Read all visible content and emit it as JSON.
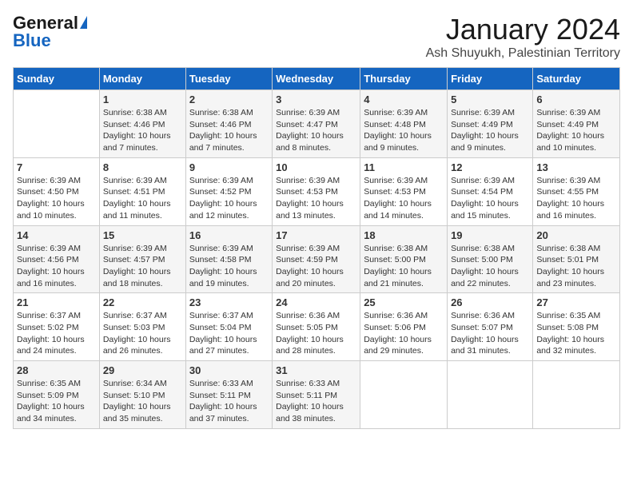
{
  "header": {
    "logo_general": "General",
    "logo_blue": "Blue",
    "month_title": "January 2024",
    "location": "Ash Shuyukh, Palestinian Territory"
  },
  "days_of_week": [
    "Sunday",
    "Monday",
    "Tuesday",
    "Wednesday",
    "Thursday",
    "Friday",
    "Saturday"
  ],
  "weeks": [
    [
      {
        "day": "",
        "sunrise": "",
        "sunset": "",
        "daylight": ""
      },
      {
        "day": "1",
        "sunrise": "Sunrise: 6:38 AM",
        "sunset": "Sunset: 4:46 PM",
        "daylight": "Daylight: 10 hours and 7 minutes."
      },
      {
        "day": "2",
        "sunrise": "Sunrise: 6:38 AM",
        "sunset": "Sunset: 4:46 PM",
        "daylight": "Daylight: 10 hours and 7 minutes."
      },
      {
        "day": "3",
        "sunrise": "Sunrise: 6:39 AM",
        "sunset": "Sunset: 4:47 PM",
        "daylight": "Daylight: 10 hours and 8 minutes."
      },
      {
        "day": "4",
        "sunrise": "Sunrise: 6:39 AM",
        "sunset": "Sunset: 4:48 PM",
        "daylight": "Daylight: 10 hours and 9 minutes."
      },
      {
        "day": "5",
        "sunrise": "Sunrise: 6:39 AM",
        "sunset": "Sunset: 4:49 PM",
        "daylight": "Daylight: 10 hours and 9 minutes."
      },
      {
        "day": "6",
        "sunrise": "Sunrise: 6:39 AM",
        "sunset": "Sunset: 4:49 PM",
        "daylight": "Daylight: 10 hours and 10 minutes."
      }
    ],
    [
      {
        "day": "7",
        "sunrise": "Sunrise: 6:39 AM",
        "sunset": "Sunset: 4:50 PM",
        "daylight": "Daylight: 10 hours and 10 minutes."
      },
      {
        "day": "8",
        "sunrise": "Sunrise: 6:39 AM",
        "sunset": "Sunset: 4:51 PM",
        "daylight": "Daylight: 10 hours and 11 minutes."
      },
      {
        "day": "9",
        "sunrise": "Sunrise: 6:39 AM",
        "sunset": "Sunset: 4:52 PM",
        "daylight": "Daylight: 10 hours and 12 minutes."
      },
      {
        "day": "10",
        "sunrise": "Sunrise: 6:39 AM",
        "sunset": "Sunset: 4:53 PM",
        "daylight": "Daylight: 10 hours and 13 minutes."
      },
      {
        "day": "11",
        "sunrise": "Sunrise: 6:39 AM",
        "sunset": "Sunset: 4:53 PM",
        "daylight": "Daylight: 10 hours and 14 minutes."
      },
      {
        "day": "12",
        "sunrise": "Sunrise: 6:39 AM",
        "sunset": "Sunset: 4:54 PM",
        "daylight": "Daylight: 10 hours and 15 minutes."
      },
      {
        "day": "13",
        "sunrise": "Sunrise: 6:39 AM",
        "sunset": "Sunset: 4:55 PM",
        "daylight": "Daylight: 10 hours and 16 minutes."
      }
    ],
    [
      {
        "day": "14",
        "sunrise": "Sunrise: 6:39 AM",
        "sunset": "Sunset: 4:56 PM",
        "daylight": "Daylight: 10 hours and 16 minutes."
      },
      {
        "day": "15",
        "sunrise": "Sunrise: 6:39 AM",
        "sunset": "Sunset: 4:57 PM",
        "daylight": "Daylight: 10 hours and 18 minutes."
      },
      {
        "day": "16",
        "sunrise": "Sunrise: 6:39 AM",
        "sunset": "Sunset: 4:58 PM",
        "daylight": "Daylight: 10 hours and 19 minutes."
      },
      {
        "day": "17",
        "sunrise": "Sunrise: 6:39 AM",
        "sunset": "Sunset: 4:59 PM",
        "daylight": "Daylight: 10 hours and 20 minutes."
      },
      {
        "day": "18",
        "sunrise": "Sunrise: 6:38 AM",
        "sunset": "Sunset: 5:00 PM",
        "daylight": "Daylight: 10 hours and 21 minutes."
      },
      {
        "day": "19",
        "sunrise": "Sunrise: 6:38 AM",
        "sunset": "Sunset: 5:00 PM",
        "daylight": "Daylight: 10 hours and 22 minutes."
      },
      {
        "day": "20",
        "sunrise": "Sunrise: 6:38 AM",
        "sunset": "Sunset: 5:01 PM",
        "daylight": "Daylight: 10 hours and 23 minutes."
      }
    ],
    [
      {
        "day": "21",
        "sunrise": "Sunrise: 6:37 AM",
        "sunset": "Sunset: 5:02 PM",
        "daylight": "Daylight: 10 hours and 24 minutes."
      },
      {
        "day": "22",
        "sunrise": "Sunrise: 6:37 AM",
        "sunset": "Sunset: 5:03 PM",
        "daylight": "Daylight: 10 hours and 26 minutes."
      },
      {
        "day": "23",
        "sunrise": "Sunrise: 6:37 AM",
        "sunset": "Sunset: 5:04 PM",
        "daylight": "Daylight: 10 hours and 27 minutes."
      },
      {
        "day": "24",
        "sunrise": "Sunrise: 6:36 AM",
        "sunset": "Sunset: 5:05 PM",
        "daylight": "Daylight: 10 hours and 28 minutes."
      },
      {
        "day": "25",
        "sunrise": "Sunrise: 6:36 AM",
        "sunset": "Sunset: 5:06 PM",
        "daylight": "Daylight: 10 hours and 29 minutes."
      },
      {
        "day": "26",
        "sunrise": "Sunrise: 6:36 AM",
        "sunset": "Sunset: 5:07 PM",
        "daylight": "Daylight: 10 hours and 31 minutes."
      },
      {
        "day": "27",
        "sunrise": "Sunrise: 6:35 AM",
        "sunset": "Sunset: 5:08 PM",
        "daylight": "Daylight: 10 hours and 32 minutes."
      }
    ],
    [
      {
        "day": "28",
        "sunrise": "Sunrise: 6:35 AM",
        "sunset": "Sunset: 5:09 PM",
        "daylight": "Daylight: 10 hours and 34 minutes."
      },
      {
        "day": "29",
        "sunrise": "Sunrise: 6:34 AM",
        "sunset": "Sunset: 5:10 PM",
        "daylight": "Daylight: 10 hours and 35 minutes."
      },
      {
        "day": "30",
        "sunrise": "Sunrise: 6:33 AM",
        "sunset": "Sunset: 5:11 PM",
        "daylight": "Daylight: 10 hours and 37 minutes."
      },
      {
        "day": "31",
        "sunrise": "Sunrise: 6:33 AM",
        "sunset": "Sunset: 5:11 PM",
        "daylight": "Daylight: 10 hours and 38 minutes."
      },
      {
        "day": "",
        "sunrise": "",
        "sunset": "",
        "daylight": ""
      },
      {
        "day": "",
        "sunrise": "",
        "sunset": "",
        "daylight": ""
      },
      {
        "day": "",
        "sunrise": "",
        "sunset": "",
        "daylight": ""
      }
    ]
  ]
}
